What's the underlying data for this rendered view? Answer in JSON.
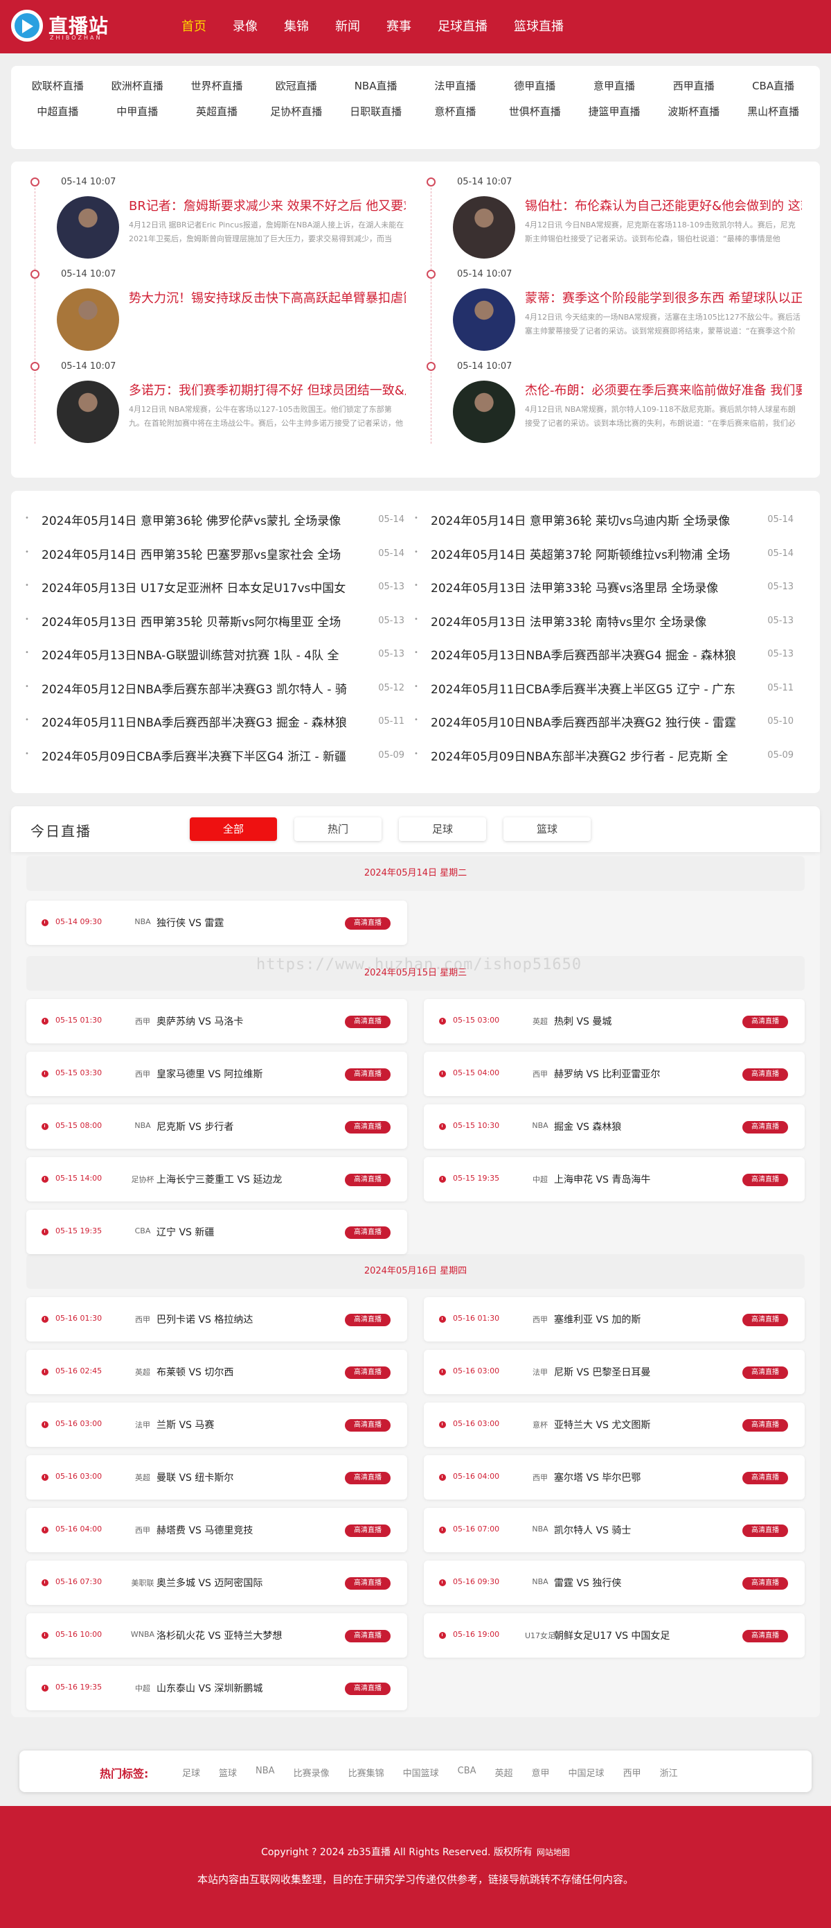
{
  "logo": {
    "name": "直播站",
    "sub": "ZHIBOZHAN"
  },
  "nav": [
    "首页",
    "录像",
    "集锦",
    "新闻",
    "赛事",
    "足球直播",
    "篮球直播"
  ],
  "leagues": [
    "欧联杯直播",
    "欧洲杯直播",
    "世界杯直播",
    "欧冠直播",
    "NBA直播",
    "法甲直播",
    "德甲直播",
    "意甲直播",
    "西甲直播",
    "CBA直播",
    "中超直播",
    "中甲直播",
    "英超直播",
    "足协杯直播",
    "日职联直播",
    "意杯直播",
    "世俱杯直播",
    "捷篮甲直播",
    "波斯杯直播",
    "黑山杯直播"
  ],
  "news_left": [
    {
      "time": "05-14 10:07",
      "title": "BR记者：詹姆斯要求减少来 效果不好之后 他又要求",
      "desc": "4月12日讯 据BR记者Eric Pincus报道，詹姆斯在NBA湖人接上诉，在湖人未能在2021年卫冕后，詹姆斯曾向管理层施加了巨大压力，要求交易得到减少，而当"
    },
    {
      "time": "05-14 10:07",
      "title": "势大力沉！锡安持球反击快下高高跃起单臂暴扣虐筐",
      "desc": ""
    },
    {
      "time": "05-14 10:07",
      "title": "多诺万：我们赛季初期打得不好 但球员团结一致&从",
      "desc": "4月12日讯 NBA常规赛，公牛在客场以127-105击败国王。他们锁定了东部第九。在首轮附加赛中将在主场战公牛。赛后，公牛主帅多诺万接受了记者采访，他"
    }
  ],
  "news_right": [
    {
      "time": "05-14 10:07",
      "title": "锡伯杜：布伦森认为自己还能更好&他会做到的 这就",
      "desc": "4月12日讯 今日NBA常规赛，尼克斯在客场118-109击败凯尔特人。赛后，尼克斯主帅锡伯杜接受了记者采访。谈到布伦森，锡伯杜说道：“最棒的事情是他"
    },
    {
      "time": "05-14 10:07",
      "title": "蒙蒂：赛季这个阶段能学到很多东西 希望球队以正确",
      "desc": "4月12日讯 今天结束的一场NBA常规赛，活塞在主场105比127不敌公牛。赛后活塞主帅蒙蒂接受了记者的采访。谈到常规赛即将结束，蒙蒂说道：“在赛季这个阶"
    },
    {
      "time": "05-14 10:07",
      "title": "杰伦-布朗：必须要在季后赛来临前做好准备 我们要迎",
      "desc": "4月12日讯 NBA常规赛，凯尔特人109-118不敌尼克斯。赛后凯尔特人球星布朗接受了记者的采访。谈到本场比赛的失利，布朗说道：“在季后赛来临前，我们必"
    }
  ],
  "replays_left": [
    {
      "title": "2024年05月14日 意甲第36轮 佛罗伦萨vs蒙扎 全场录像",
      "date": "05-14"
    },
    {
      "title": "2024年05月14日 西甲第35轮 巴塞罗那vs皇家社会 全场",
      "date": "05-14"
    },
    {
      "title": "2024年05月13日 U17女足亚洲杯 日本女足U17vs中国女",
      "date": "05-13"
    },
    {
      "title": "2024年05月13日 西甲第35轮 贝蒂斯vs阿尔梅里亚 全场",
      "date": "05-13"
    },
    {
      "title": "2024年05月13日NBA-G联盟训练营对抗赛 1队 - 4队 全",
      "date": "05-13"
    },
    {
      "title": "2024年05月12日NBA季后赛东部半决赛G3 凯尔特人 - 骑",
      "date": "05-12"
    },
    {
      "title": "2024年05月11日NBA季后赛西部半决赛G3 掘金 - 森林狼",
      "date": "05-11"
    },
    {
      "title": "2024年05月09日CBA季后赛半决赛下半区G4 浙江 - 新疆",
      "date": "05-09"
    }
  ],
  "replays_right": [
    {
      "title": "2024年05月14日 意甲第36轮 莱切vs乌迪内斯 全场录像",
      "date": "05-14"
    },
    {
      "title": "2024年05月14日 英超第37轮 阿斯顿维拉vs利物浦 全场",
      "date": "05-14"
    },
    {
      "title": "2024年05月13日 法甲第33轮 马赛vs洛里昂 全场录像",
      "date": "05-13"
    },
    {
      "title": "2024年05月13日 法甲第33轮 南特vs里尔 全场录像",
      "date": "05-13"
    },
    {
      "title": "2024年05月13日NBA季后赛西部半决赛G4 掘金 - 森林狼",
      "date": "05-13"
    },
    {
      "title": "2024年05月11日CBA季后赛半决赛上半区G5 辽宁 - 广东",
      "date": "05-11"
    },
    {
      "title": "2024年05月10日NBA季后赛西部半决赛G2 独行侠 - 雷霆",
      "date": "05-10"
    },
    {
      "title": "2024年05月09日NBA东部半决赛G2 步行者 - 尼克斯 全",
      "date": "05-09"
    }
  ],
  "live": {
    "title": "今日直播",
    "tabs": [
      "全部",
      "热门",
      "足球",
      "篮球"
    ],
    "day1": "2024年05月14日 星期二",
    "day2": "2024年05月15日 星期三",
    "day3": "2024年05月16日 星期四",
    "watermark": "https://www.huzhan.com/ishop51650",
    "button_label": "高清直播",
    "day1_matches": [
      {
        "time": "05-14 09:30",
        "league": "NBA",
        "teams": "独行侠 VS 雷霆"
      }
    ],
    "day2_matches": [
      {
        "time": "05-15 01:30",
        "league": "西甲",
        "teams": "奥萨苏纳 VS 马洛卡"
      },
      {
        "time": "05-15 03:00",
        "league": "英超",
        "teams": "热刺 VS 曼城"
      },
      {
        "time": "05-15 03:30",
        "league": "西甲",
        "teams": "皇家马德里 VS 阿拉维斯"
      },
      {
        "time": "05-15 04:00",
        "league": "西甲",
        "teams": "赫罗纳 VS 比利亚雷亚尔"
      },
      {
        "time": "05-15 08:00",
        "league": "NBA",
        "teams": "尼克斯 VS 步行者"
      },
      {
        "time": "05-15 10:30",
        "league": "NBA",
        "teams": "掘金 VS 森林狼"
      },
      {
        "time": "05-15 14:00",
        "league": "足协杯",
        "teams": "上海长宁三菱重工 VS 延边龙"
      },
      {
        "time": "05-15 19:35",
        "league": "中超",
        "teams": "上海申花 VS 青岛海牛"
      },
      {
        "time": "05-15 19:35",
        "league": "CBA",
        "teams": "辽宁 VS 新疆"
      }
    ],
    "day3_matches": [
      {
        "time": "05-16 01:30",
        "league": "西甲",
        "teams": "巴列卡诺 VS 格拉纳达"
      },
      {
        "time": "05-16 01:30",
        "league": "西甲",
        "teams": "塞维利亚 VS 加的斯"
      },
      {
        "time": "05-16 02:45",
        "league": "英超",
        "teams": "布莱顿 VS 切尔西"
      },
      {
        "time": "05-16 03:00",
        "league": "法甲",
        "teams": "尼斯 VS 巴黎圣日耳曼"
      },
      {
        "time": "05-16 03:00",
        "league": "法甲",
        "teams": "兰斯 VS 马赛"
      },
      {
        "time": "05-16 03:00",
        "league": "意杯",
        "teams": "亚特兰大 VS 尤文图斯"
      },
      {
        "time": "05-16 03:00",
        "league": "英超",
        "teams": "曼联 VS 纽卡斯尔"
      },
      {
        "time": "05-16 04:00",
        "league": "西甲",
        "teams": "塞尔塔 VS 毕尔巴鄂"
      },
      {
        "time": "05-16 04:00",
        "league": "西甲",
        "teams": "赫塔费 VS 马德里竞技"
      },
      {
        "time": "05-16 07:00",
        "league": "NBA",
        "teams": "凯尔特人 VS 骑士"
      },
      {
        "time": "05-16 07:30",
        "league": "美职联",
        "teams": "奥兰多城 VS 迈阿密国际"
      },
      {
        "time": "05-16 09:30",
        "league": "NBA",
        "teams": "雷霆 VS 独行侠"
      },
      {
        "time": "05-16 10:00",
        "league": "WNBA",
        "teams": "洛杉矶火花 VS 亚特兰大梦想"
      },
      {
        "time": "05-16 19:00",
        "league": "U17女足",
        "teams": "朝鲜女足U17 VS 中国女足"
      },
      {
        "time": "05-16 19:35",
        "league": "中超",
        "teams": "山东泰山 VS 深圳新鹏城"
      }
    ]
  },
  "tags": {
    "label": "热门标签:",
    "items": [
      "足球",
      "篮球",
      "NBA",
      "比赛录像",
      "比赛集锦",
      "中国篮球",
      "CBA",
      "英超",
      "意甲",
      "中国足球",
      "西甲",
      "浙江"
    ]
  },
  "footer": {
    "copyright": "Copyright ? 2024 zb35直播 All Rights Reserved. 版权所有",
    "sitemap": "网站地图",
    "disclaimer": "本站内容由互联网收集整理，目的在于研究学习传递仅供参考，链接导航跳转不存储任何内容。"
  },
  "colors": {
    "brand": "#c81c33",
    "nav_active": "#ffd800",
    "tab_active": "#ee1111",
    "logo_blue": "#2aa0e0"
  }
}
